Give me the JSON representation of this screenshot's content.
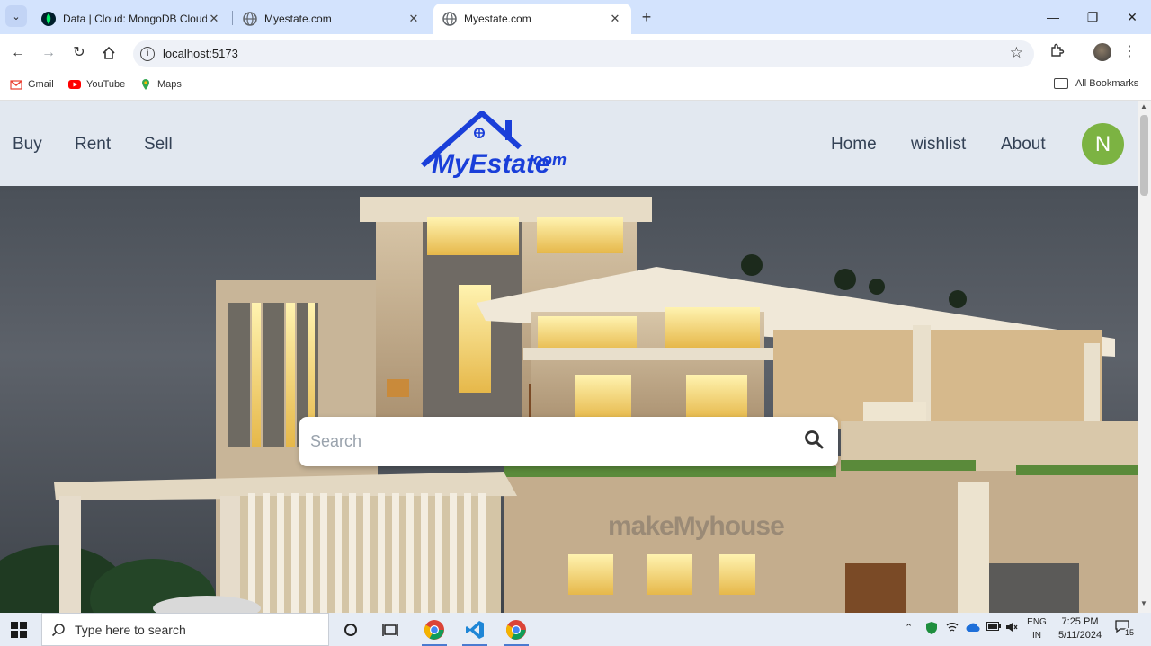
{
  "browser": {
    "tabs": [
      {
        "title": "Data | Cloud: MongoDB Cloud",
        "favicon_color": "#00a35c",
        "active": false
      },
      {
        "title": "Myestate.com",
        "favicon_color": "#5f6368",
        "active": false
      },
      {
        "title": "Myestate.com",
        "favicon_color": "#5f6368",
        "active": true
      }
    ],
    "url": "localhost:5173",
    "bookmarks": [
      {
        "label": "Gmail",
        "color": "#ea4335"
      },
      {
        "label": "YouTube",
        "color": "#ff0000"
      },
      {
        "label": "Maps",
        "color": "#34a853"
      }
    ],
    "all_bookmarks": "All Bookmarks"
  },
  "site": {
    "nav_left": [
      "Buy",
      "Rent",
      "Sell"
    ],
    "nav_right": [
      "Home",
      "wishlist",
      "About"
    ],
    "logo_text": "MyEstate.com",
    "logo_color": "#1a3fd9",
    "avatar_initial": "N",
    "avatar_color": "#7cb342",
    "search_placeholder": "Search",
    "hero_watermark": "makeMyhouse"
  },
  "taskbar": {
    "search_placeholder": "Type here to search",
    "lang_line1": "ENG",
    "lang_line2": "IN",
    "time": "7:25 PM",
    "date": "5/11/2024",
    "notifications": "15"
  }
}
